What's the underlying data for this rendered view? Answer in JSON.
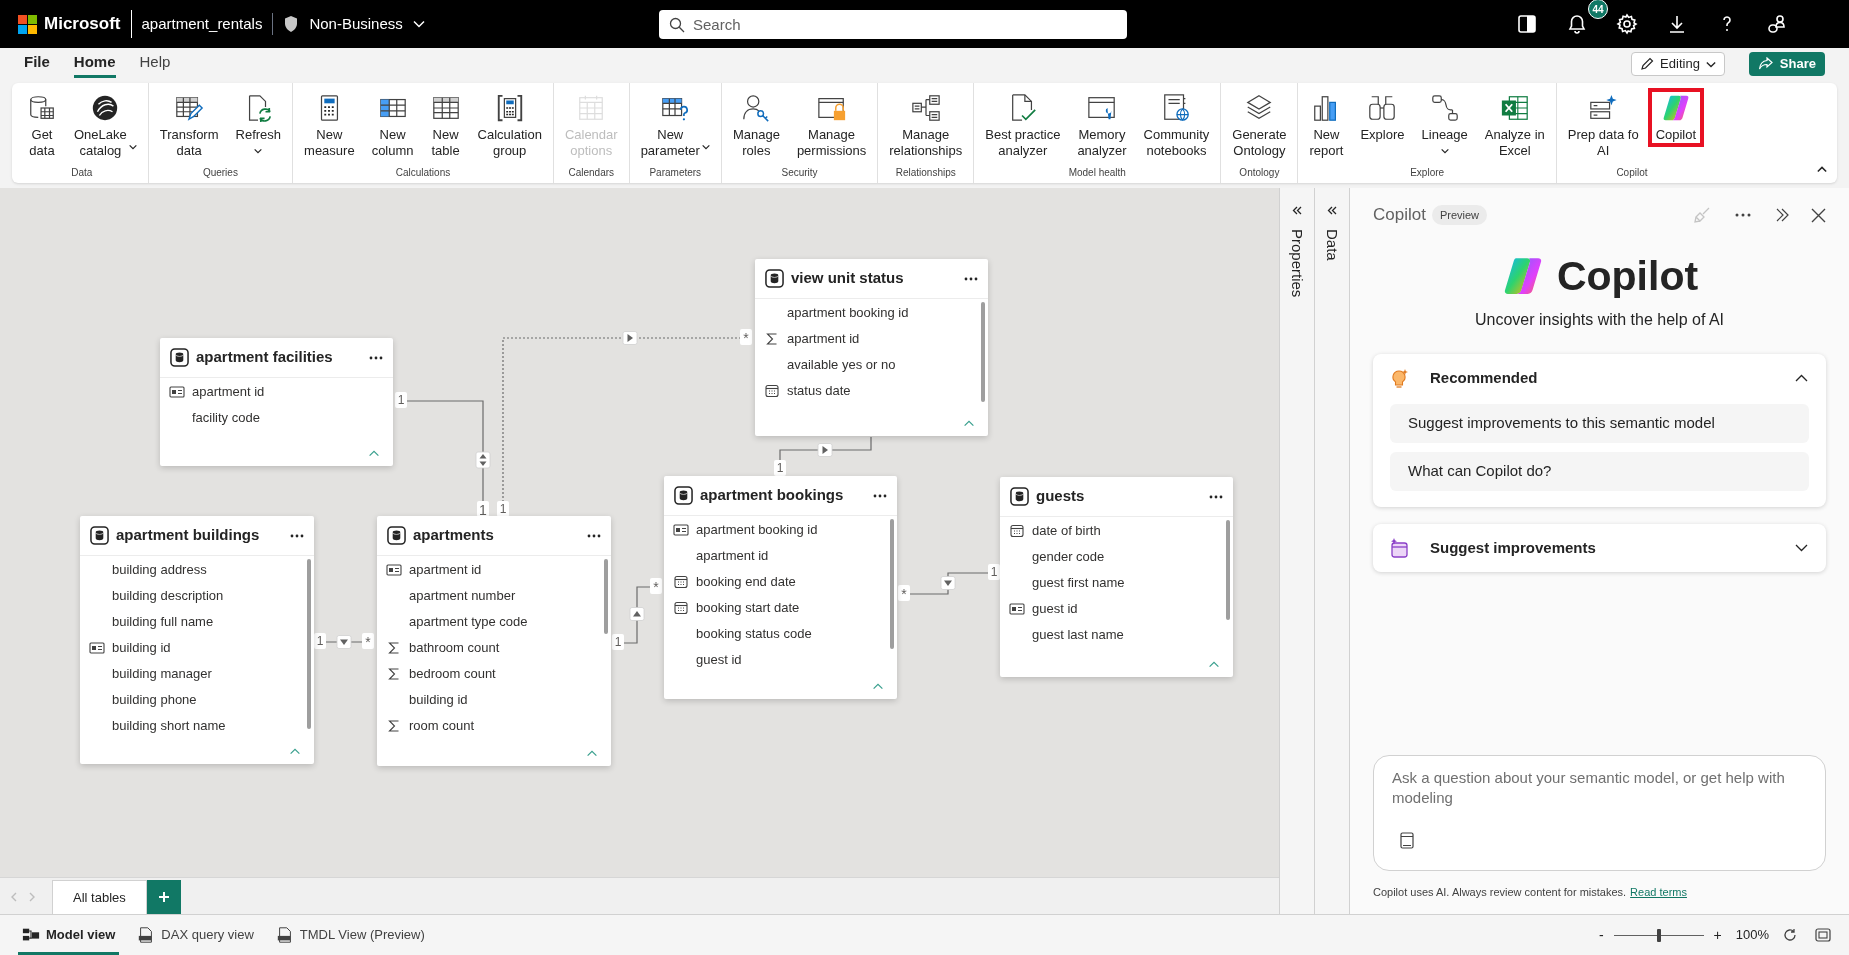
{
  "app": {
    "brand": "Microsoft",
    "workspace": "apartment_rentals",
    "label": "Non-Business",
    "search_placeholder": "Search",
    "notifications": "44"
  },
  "menu_tabs": [
    {
      "label": "File",
      "selected": false
    },
    {
      "label": "Home",
      "selected": true
    },
    {
      "label": "Help",
      "selected": false
    }
  ],
  "mode_button": "Editing",
  "share_button": "Share",
  "ribbon_groups": [
    {
      "title": "Data",
      "buttons": [
        {
          "label": "Get\ndata",
          "dropdown": false,
          "disabled": false,
          "highlighted": false
        },
        {
          "label": "OneLake\ncatalog",
          "dropdown": true,
          "disabled": false,
          "highlighted": false
        }
      ]
    },
    {
      "title": "Queries",
      "buttons": [
        {
          "label": "Transform\ndata",
          "dropdown": false,
          "disabled": false,
          "highlighted": false
        },
        {
          "label": "Refresh",
          "dropdown": true,
          "disabled": false,
          "highlighted": false
        }
      ]
    },
    {
      "title": "Calculations",
      "buttons": [
        {
          "label": "New\nmeasure",
          "dropdown": false,
          "disabled": false,
          "highlighted": false
        },
        {
          "label": "New\ncolumn",
          "dropdown": false,
          "disabled": false,
          "highlighted": false
        },
        {
          "label": "New\ntable",
          "dropdown": false,
          "disabled": false,
          "highlighted": false
        },
        {
          "label": "Calculation\ngroup",
          "dropdown": false,
          "disabled": false,
          "highlighted": false
        }
      ]
    },
    {
      "title": "Calendars",
      "buttons": [
        {
          "label": "Calendar\noptions",
          "dropdown": false,
          "disabled": true,
          "highlighted": false
        }
      ]
    },
    {
      "title": "Parameters",
      "buttons": [
        {
          "label": "New\nparameter",
          "dropdown": true,
          "disabled": false,
          "highlighted": false
        }
      ]
    },
    {
      "title": "Security",
      "buttons": [
        {
          "label": "Manage\nroles",
          "dropdown": false,
          "disabled": false,
          "highlighted": false
        },
        {
          "label": "Manage\npermissions",
          "dropdown": false,
          "disabled": false,
          "highlighted": false
        }
      ]
    },
    {
      "title": "Relationships",
      "buttons": [
        {
          "label": "Manage\nrelationships",
          "dropdown": false,
          "disabled": false,
          "highlighted": false
        }
      ]
    },
    {
      "title": "Model health",
      "buttons": [
        {
          "label": "Best practice\nanalyzer",
          "dropdown": false,
          "disabled": false,
          "highlighted": false
        },
        {
          "label": "Memory\nanalyzer",
          "dropdown": false,
          "disabled": false,
          "highlighted": false
        },
        {
          "label": "Community\nnotebooks",
          "dropdown": false,
          "disabled": false,
          "highlighted": false
        }
      ]
    },
    {
      "title": "Ontology",
      "buttons": [
        {
          "label": "Generate\nOntology",
          "dropdown": false,
          "disabled": false,
          "highlighted": false
        }
      ]
    },
    {
      "title": "Explore",
      "buttons": [
        {
          "label": "New\nreport",
          "dropdown": false,
          "disabled": false,
          "highlighted": false
        },
        {
          "label": "Explore",
          "dropdown": false,
          "disabled": false,
          "highlighted": false
        },
        {
          "label": "Lineage",
          "dropdown": true,
          "disabled": false,
          "highlighted": false
        },
        {
          "label": "Analyze in\nExcel",
          "dropdown": false,
          "disabled": false,
          "highlighted": false
        }
      ]
    },
    {
      "title": "Copilot",
      "buttons": [
        {
          "label": "Prep data fo\nAI",
          "dropdown": false,
          "disabled": false,
          "highlighted": false
        },
        {
          "label": "Copilot",
          "dropdown": false,
          "disabled": false,
          "highlighted": true
        }
      ]
    }
  ],
  "tables": [
    {
      "title": "apartment facilities",
      "columns": [
        {
          "name": "apartment id",
          "kind": "key"
        },
        {
          "name": "facility code",
          "kind": "plain"
        }
      ]
    },
    {
      "title": "view unit status",
      "columns": [
        {
          "name": "apartment booking id",
          "kind": "plain"
        },
        {
          "name": "apartment id",
          "kind": "sum"
        },
        {
          "name": "available yes or no",
          "kind": "plain"
        },
        {
          "name": "status date",
          "kind": "date"
        }
      ]
    },
    {
      "title": "apartment buildings",
      "columns": [
        {
          "name": "building address",
          "kind": "plain"
        },
        {
          "name": "building description",
          "kind": "plain"
        },
        {
          "name": "building full name",
          "kind": "plain"
        },
        {
          "name": "building id",
          "kind": "key"
        },
        {
          "name": "building manager",
          "kind": "plain"
        },
        {
          "name": "building phone",
          "kind": "plain"
        },
        {
          "name": "building short name",
          "kind": "plain"
        }
      ]
    },
    {
      "title": "apartments",
      "columns": [
        {
          "name": "apartment id",
          "kind": "key"
        },
        {
          "name": "apartment number",
          "kind": "plain"
        },
        {
          "name": "apartment type code",
          "kind": "plain"
        },
        {
          "name": "bathroom count",
          "kind": "sum"
        },
        {
          "name": "bedroom count",
          "kind": "sum"
        },
        {
          "name": "building id",
          "kind": "plain"
        },
        {
          "name": "room count",
          "kind": "sum"
        }
      ]
    },
    {
      "title": "apartment bookings",
      "columns": [
        {
          "name": "apartment booking id",
          "kind": "key"
        },
        {
          "name": "apartment id",
          "kind": "plain"
        },
        {
          "name": "booking end date",
          "kind": "date"
        },
        {
          "name": "booking start date",
          "kind": "date"
        },
        {
          "name": "booking status code",
          "kind": "plain"
        },
        {
          "name": "guest id",
          "kind": "plain"
        }
      ]
    },
    {
      "title": "guests",
      "columns": [
        {
          "name": "date of birth",
          "kind": "date"
        },
        {
          "name": "gender code",
          "kind": "plain"
        },
        {
          "name": "guest first name",
          "kind": "plain"
        },
        {
          "name": "guest id",
          "kind": "key"
        },
        {
          "name": "guest last name",
          "kind": "plain"
        }
      ]
    }
  ],
  "relationships": [
    {
      "from_end": "1",
      "to_end": "1",
      "both_ways": true,
      "active": true
    },
    {
      "from_end": "1",
      "to_end": "*",
      "both_ways": false,
      "active": false
    },
    {
      "from_end": "1",
      "to_end": "*",
      "both_ways": false,
      "active": true
    },
    {
      "from_end": "1",
      "to_end": "*",
      "both_ways": false,
      "active": true
    },
    {
      "from_end": "1",
      "both_ways": false,
      "active": true
    },
    {
      "from_end": "1",
      "to_end": "*",
      "both_ways": false,
      "active": true
    }
  ],
  "side_panes": [
    {
      "label": "Properties"
    },
    {
      "label": "Data"
    }
  ],
  "copilot": {
    "title": "Copilot",
    "badge": "Preview",
    "heading": "Copilot",
    "subtitle": "Uncover insights with the help of AI",
    "sections": [
      {
        "title": "Recommended",
        "expanded": true,
        "suggestions": [
          "Suggest improvements to this semantic model",
          "What can Copilot do?"
        ]
      },
      {
        "title": "Suggest improvements",
        "expanded": false
      }
    ],
    "input_placeholder": "Ask a question about your semantic model, or get help with modeling",
    "footer": "Copilot uses AI. Always review content for mistakes.",
    "footer_link": "Read terms"
  },
  "page_tabs": [
    {
      "label": "All tables",
      "selected": true
    }
  ],
  "views": [
    {
      "label": "Model view",
      "selected": true
    },
    {
      "label": "DAX query view",
      "selected": false
    },
    {
      "label": "TMDL View (Preview)",
      "selected": false
    }
  ],
  "zoom": {
    "minus": "-",
    "plus": "+",
    "level": 0.5,
    "reading": "100%"
  }
}
